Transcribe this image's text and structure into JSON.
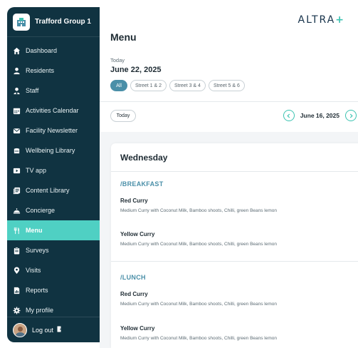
{
  "sidebar": {
    "brand_name": "Trafford Group 1",
    "items": [
      {
        "label": "Dashboard",
        "icon": "home-icon"
      },
      {
        "label": "Residents",
        "icon": "person-icon"
      },
      {
        "label": "Staff",
        "icon": "staff-icon"
      },
      {
        "label": "Activities Calendar",
        "icon": "calendar-icon"
      },
      {
        "label": "Facility Newsletter",
        "icon": "mail-icon"
      },
      {
        "label": "Wellbeing Library",
        "icon": "library-icon"
      },
      {
        "label": "TV app",
        "icon": "play-icon"
      },
      {
        "label": "Content Library",
        "icon": "content-icon"
      },
      {
        "label": "Concierge",
        "icon": "bell-icon"
      },
      {
        "label": "Menu",
        "icon": "cutlery-icon",
        "active": true
      },
      {
        "label": "Surveys",
        "icon": "clipboard-icon"
      },
      {
        "label": "Visits",
        "icon": "location-icon"
      },
      {
        "label": "Reports",
        "icon": "report-icon"
      },
      {
        "label": "My profile",
        "icon": "gear-icon"
      }
    ],
    "logout_label": "Log out"
  },
  "header": {
    "logo_text": "ALTRA",
    "logo_plus": "+",
    "title": "Menu",
    "today_label": "Today",
    "date": "June 22, 2025",
    "filters": [
      "All",
      "Street 1 & 2",
      "Street 3 & 4",
      "Street 5 & 6"
    ],
    "active_filter": "All"
  },
  "date_nav": {
    "today_button": "Today",
    "date": "June 16, 2025"
  },
  "menu": {
    "day": "Wednesday",
    "sections": [
      {
        "title": "/BREAKFAST",
        "dishes": [
          {
            "name": "Red Curry",
            "description": "Medium Curry with Coconut Milk, Bamboo shoots, Chilli, green Beans lemon"
          },
          {
            "name": "Yellow Curry",
            "description": "Medium Curry with Coconut Milk, Bamboo shoots, Chilli, green Beans lemon"
          }
        ]
      },
      {
        "title": "/LUNCH",
        "dishes": [
          {
            "name": "Red Curry",
            "description": "Medium Curry with Coconut Milk, Bamboo shoots, Chilli, green Beans lemon"
          },
          {
            "name": "Yellow Curry",
            "description": "Medium Curry with Coconut Milk, Bamboo shoots, Chilli, green Beans lemon"
          }
        ]
      }
    ]
  },
  "colors": {
    "sidebar": "#103341",
    "active": "#4fd0c3",
    "accent": "#4a8fa8",
    "logo_plus": "#3bc3b1"
  }
}
